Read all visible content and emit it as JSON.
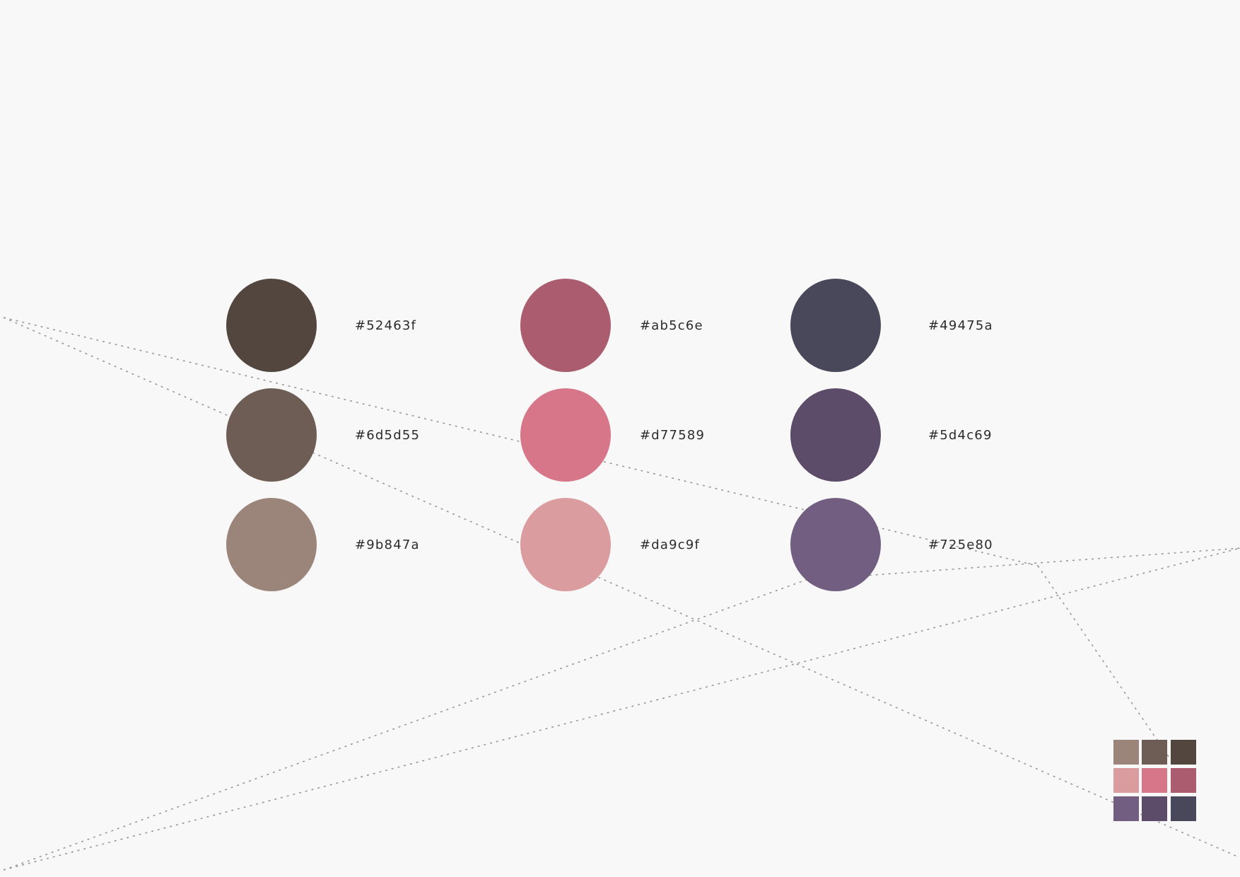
{
  "palette": {
    "columns": [
      {
        "swatches": [
          {
            "hex": "#52463f",
            "label": "#52463f"
          },
          {
            "hex": "#6d5d55",
            "label": "#6d5d55"
          },
          {
            "hex": "#9b847a",
            "label": "#9b847a"
          }
        ]
      },
      {
        "swatches": [
          {
            "hex": "#ab5c6e",
            "label": "#ab5c6e"
          },
          {
            "hex": "#d77589",
            "label": "#d77589"
          },
          {
            "hex": "#da9c9f",
            "label": "#da9c9f"
          }
        ]
      },
      {
        "swatches": [
          {
            "hex": "#49475a",
            "label": "#49475a"
          },
          {
            "hex": "#5d4c69",
            "label": "#5d4c69"
          },
          {
            "hex": "#725e80",
            "label": "#725e80"
          }
        ]
      }
    ]
  },
  "mini_grid": {
    "rows": [
      [
        "#9b847a",
        "#6d5d55",
        "#52463f"
      ],
      [
        "#da9c9f",
        "#d77589",
        "#ab5c6e"
      ],
      [
        "#725e80",
        "#5d4c69",
        "#49475a"
      ]
    ]
  },
  "colors": {
    "background": "#f8f8f8",
    "guide_line": "#999999",
    "label_text": "#2b2b2b"
  }
}
